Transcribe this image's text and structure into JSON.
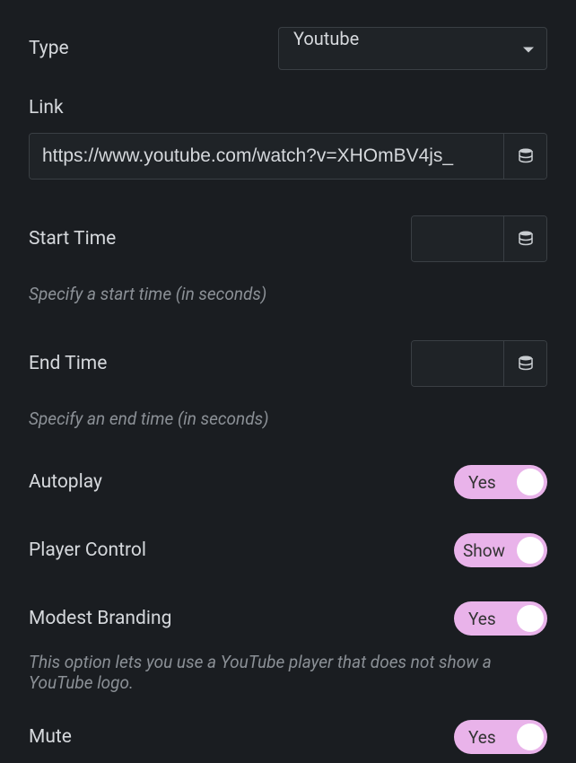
{
  "type": {
    "label": "Type",
    "selected": "Youtube"
  },
  "link": {
    "label": "Link",
    "value": "https://www.youtube.com/watch?v=XHOmBV4js_"
  },
  "startTime": {
    "label": "Start Time",
    "value": "",
    "help": "Specify a start time (in seconds)"
  },
  "endTime": {
    "label": "End Time",
    "value": "",
    "help": "Specify an end time (in seconds)"
  },
  "autoplay": {
    "label": "Autoplay",
    "state": "Yes"
  },
  "playerControl": {
    "label": "Player Control",
    "state": "Show"
  },
  "modestBranding": {
    "label": "Modest Branding",
    "state": "Yes",
    "help": "This option lets you use a YouTube player that does not show a YouTube logo."
  },
  "mute": {
    "label": "Mute",
    "state": "Yes"
  }
}
